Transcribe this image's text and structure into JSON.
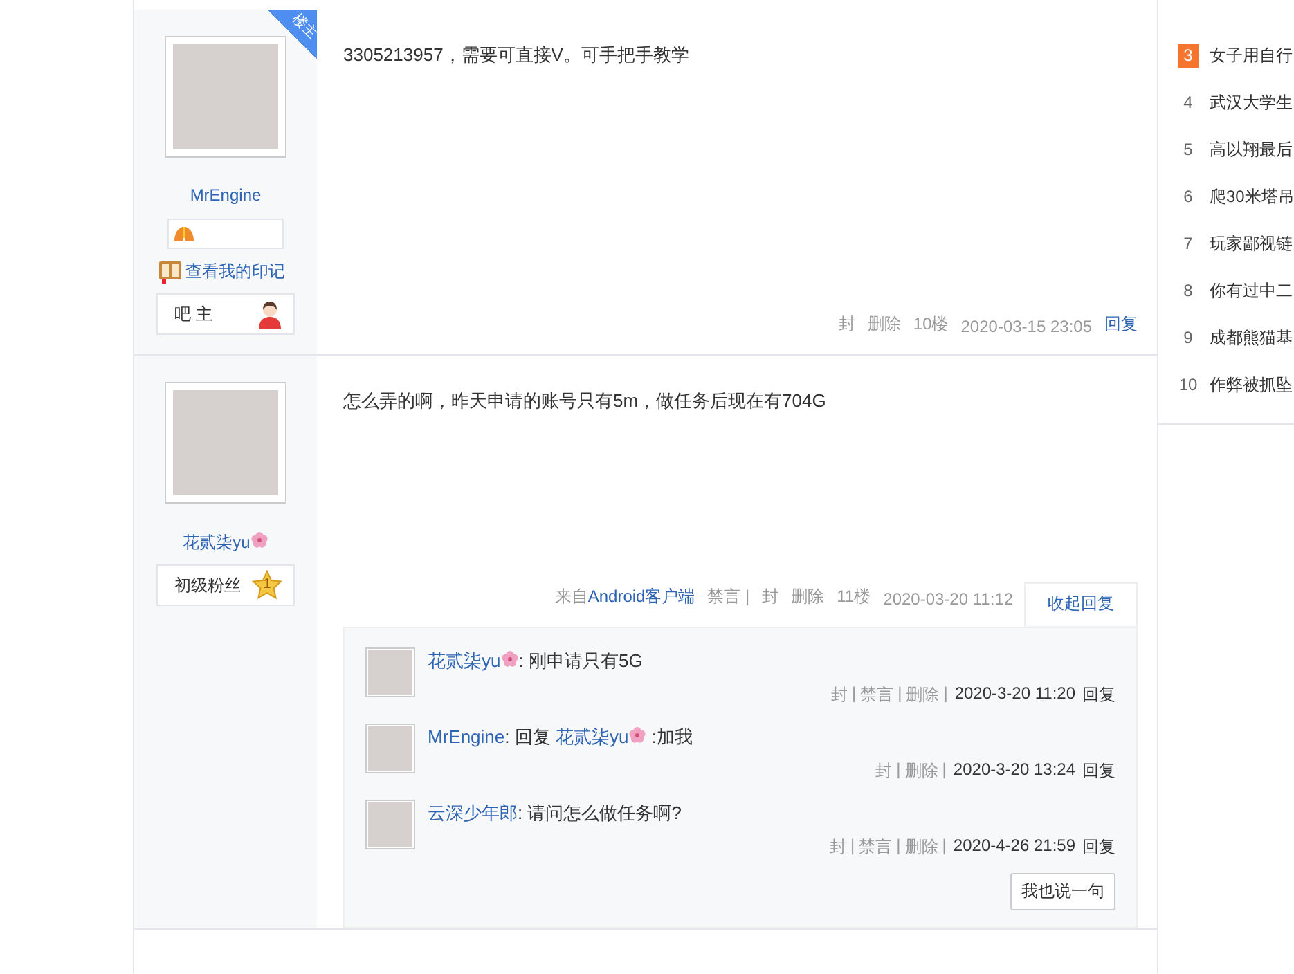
{
  "posts": [
    {
      "author": {
        "name": "MrEngine",
        "flower": false
      },
      "corner_badge": "楼主",
      "medal_box": true,
      "imprint_link": "查看我的印记",
      "role": {
        "kind": "owner",
        "label": "吧 主"
      },
      "content": "3305213957，需要可直接V。可手把手教学",
      "footer": [
        {
          "text": "封",
          "kind": "plain"
        },
        {
          "text": "删除",
          "kind": "plain"
        },
        {
          "text": "10楼",
          "kind": "plain"
        },
        {
          "text": "2020-03-15 23:05",
          "kind": "plain"
        },
        {
          "text": "回复",
          "kind": "link"
        }
      ]
    },
    {
      "author": {
        "name": "花贰柒yu",
        "flower": true
      },
      "role": {
        "kind": "fan",
        "label": "初级粉丝",
        "level": "1"
      },
      "content": "怎么弄的啊，昨天申请的账号只有5m，做任务后现在有704G",
      "footer": [
        {
          "text": "来自",
          "kind": "plain"
        },
        {
          "text": "Android客户端",
          "kind": "link",
          "join": true
        },
        {
          "text": "禁言 |",
          "kind": "plain"
        },
        {
          "text": "封",
          "kind": "plain"
        },
        {
          "text": "删除",
          "kind": "plain"
        },
        {
          "text": "11楼",
          "kind": "plain"
        },
        {
          "text": "2020-03-20 11:12",
          "kind": "plain"
        }
      ],
      "replies_toggle": {
        "label": "收起回复",
        "expanded": true
      },
      "replies": {
        "separator": "|",
        "items": [
          {
            "author": "花贰柒yu",
            "flower": true,
            "text": ": 刚申请只有5G",
            "actions": [
              "封",
              "禁言",
              "删除"
            ],
            "time": "2020-3-20 11:20",
            "reply": "回复"
          },
          {
            "author": "MrEngine",
            "flower": false,
            "reply_prefix": ": 回复",
            "reply_to": "花贰柒yu",
            "reply_to_flower": true,
            "text": ":加我",
            "actions": [
              "封",
              "删除"
            ],
            "time": "2020-3-20 13:24",
            "reply": "回复"
          },
          {
            "author": "云深少年郎",
            "flower": false,
            "text": ": 请问怎么做任务啊?",
            "actions": [
              "封",
              "禁言",
              "删除"
            ],
            "time": "2020-4-26 21:59",
            "reply": "回复"
          }
        ],
        "say_button": "我也说一句"
      }
    }
  ],
  "hot_list": [
    {
      "rank": "3",
      "highlighted": true,
      "title": "女子用自行"
    },
    {
      "rank": "4",
      "highlighted": false,
      "title": "武汉大学生"
    },
    {
      "rank": "5",
      "highlighted": false,
      "title": "高以翔最后"
    },
    {
      "rank": "6",
      "highlighted": false,
      "title": "爬30米塔吊"
    },
    {
      "rank": "7",
      "highlighted": false,
      "title": "玩家鄙视链"
    },
    {
      "rank": "8",
      "highlighted": false,
      "title": "你有过中二"
    },
    {
      "rank": "9",
      "highlighted": false,
      "title": "成都熊猫基"
    },
    {
      "rank": "10",
      "highlighted": false,
      "title": "作弊被抓坠"
    }
  ]
}
